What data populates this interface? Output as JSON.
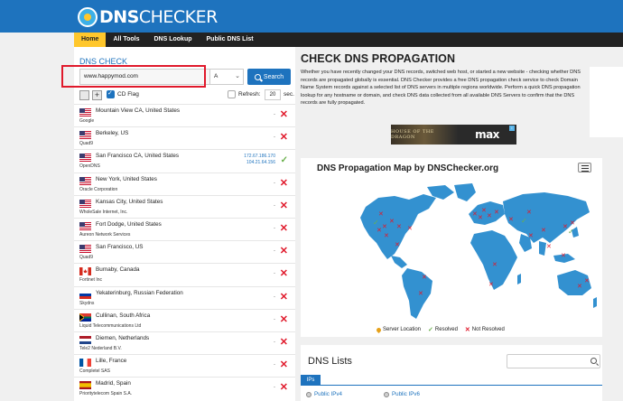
{
  "logo": {
    "dns": "DNS",
    "checker": "CHECKER"
  },
  "nav": {
    "items": [
      "Home",
      "All Tools",
      "DNS Lookup",
      "Public DNS List"
    ]
  },
  "check": {
    "title": "DNS CHECK",
    "domain_value": "www.happymod.com",
    "record_type": "A",
    "search_label": "Search",
    "plus": "+",
    "cd_flag_label": "CD Flag",
    "refresh_label": "Refresh:",
    "refresh_value": "20",
    "sec_label": "sec."
  },
  "servers": [
    {
      "location": "Mountain View CA, United States",
      "provider": "Google",
      "flag": "us",
      "result": "-",
      "status": "fail"
    },
    {
      "location": "Berkeley, US",
      "provider": "Quad9",
      "flag": "us",
      "result": "-",
      "status": "fail"
    },
    {
      "location": "San Francisco CA, United States",
      "provider": "OpenDNS",
      "flag": "us",
      "ip1": "172.67.186.170",
      "ip2": "104.21.64.156",
      "status": "ok"
    },
    {
      "location": "New York, United States",
      "provider": "Oracle Corporation",
      "flag": "us",
      "result": "-",
      "status": "fail"
    },
    {
      "location": "Kansas City, United States",
      "provider": "WholeSale Internet, Inc.",
      "flag": "us",
      "result": "-",
      "status": "fail"
    },
    {
      "location": "Fort Dodge, United States",
      "provider": "Aureon Network Services",
      "flag": "us",
      "result": "-",
      "status": "fail"
    },
    {
      "location": "San Francisco, US",
      "provider": "Quad9",
      "flag": "us",
      "result": "-",
      "status": "fail"
    },
    {
      "location": "Burnaby, Canada",
      "provider": "Fortinet Inc",
      "flag": "ca",
      "result": "-",
      "status": "fail"
    },
    {
      "location": "Yekaterinburg, Russian Federation",
      "provider": "Skydns",
      "flag": "ru",
      "result": "-",
      "status": "fail"
    },
    {
      "location": "Cullinan, South Africa",
      "provider": "Liquid Telecommunications Ltd",
      "flag": "za",
      "result": "-",
      "status": "fail"
    },
    {
      "location": "Diemen, Netherlands",
      "provider": "Tele2 Nederland B.V.",
      "flag": "nl",
      "result": "-",
      "status": "fail"
    },
    {
      "location": "Lille, France",
      "provider": "Completel SAS",
      "flag": "fr",
      "result": "-",
      "status": "fail"
    },
    {
      "location": "Madrid, Spain",
      "provider": "Prioritytelecom Spain S.A.",
      "flag": "es",
      "result": "-",
      "status": "fail"
    }
  ],
  "main": {
    "title": "CHECK DNS PROPAGATION",
    "intro": "Whether you have recently changed your DNS records, switched web host, or started a new website - checking whether DNS records are propagated globally is essential. DNS Checker provides a free DNS propagation check service to check Domain Name System records against a selected list of DNS servers in multiple regions worldwide. Perform a quick DNS propagation lookup for any hostname or domain, and check DNS data collected from all available DNS Servers to confirm that the DNS records are fully propagated."
  },
  "ad": {
    "left_text": "HOUSE OF THE DRAGON",
    "right_text": "max"
  },
  "map": {
    "title": "DNS Propagation Map by DNSChecker.org",
    "legend": {
      "server": "Server Location",
      "resolved": "Resolved",
      "not_resolved": "Not Resolved"
    },
    "colors": {
      "land": "#3391d0",
      "fail": "#e0192b",
      "ok": "#6ab04c"
    }
  },
  "lists": {
    "title": "DNS Lists",
    "tab": "IPs",
    "links": [
      "Public IPv4",
      "Public IPv6"
    ]
  }
}
